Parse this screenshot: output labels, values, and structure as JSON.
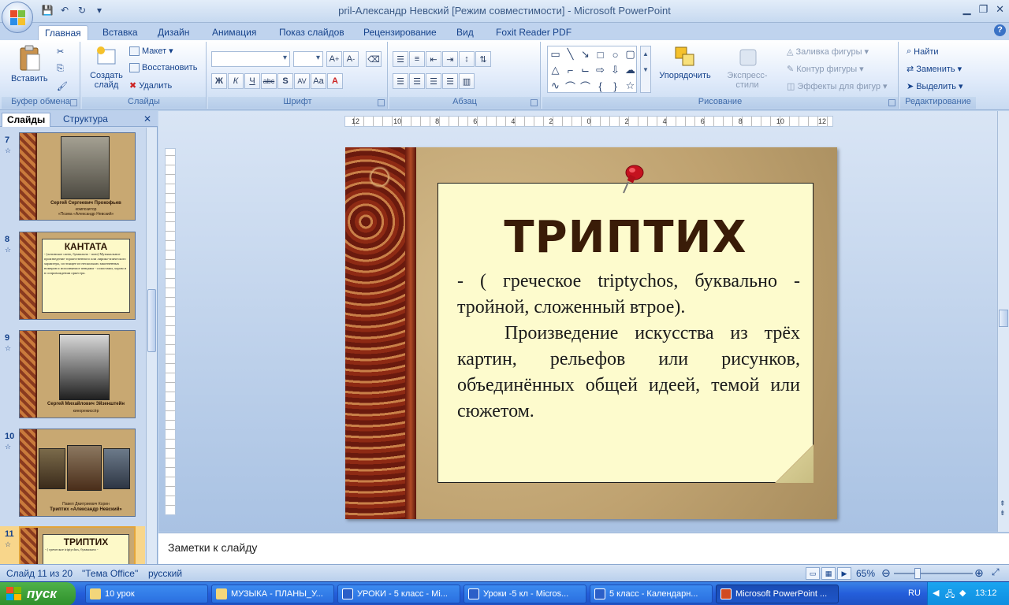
{
  "window": {
    "title": "pril-Александр Невский [Режим совместимости] - Microsoft PowerPoint"
  },
  "ribbon": {
    "tabs": [
      "Главная",
      "Вставка",
      "Дизайн",
      "Анимация",
      "Показ слайдов",
      "Рецензирование",
      "Вид",
      "Foxit Reader PDF"
    ],
    "active_tab": "Главная",
    "groups": {
      "clipboard": {
        "label": "Буфер обмена",
        "paste": "Вставить"
      },
      "slides": {
        "label": "Слайды",
        "new_slide": "Создать слайд",
        "layout": "Макет",
        "reset": "Восстановить",
        "delete": "Удалить"
      },
      "font": {
        "label": "Шрифт",
        "bold": "Ж",
        "italic": "К",
        "underline": "Ч",
        "strike": "abc",
        "shadow": "S",
        "spacing": "AV",
        "case": "Aa"
      },
      "paragraph": {
        "label": "Абзац"
      },
      "drawing": {
        "label": "Рисование",
        "arrange": "Упорядочить",
        "quick_styles": "Экспресс-стили",
        "fill": "Заливка фигуры",
        "outline": "Контур фигуры",
        "effects": "Эффекты для фигур"
      },
      "editing": {
        "label": "Редактирование",
        "find": "Найти",
        "replace": "Заменить",
        "select": "Выделить"
      }
    }
  },
  "left_panel": {
    "tabs": [
      "Слайды",
      "Структура"
    ],
    "active_tab": "Слайды",
    "thumbnails": [
      {
        "num": "7",
        "caption": "Сергей Сергеевич Прокофьев",
        "sub": "композитор",
        "sub2": "«Поэма «Александр Невский»"
      },
      {
        "num": "8",
        "title": "КАНТАТА",
        "body": "- (латинское canto, буквально - пою) Музыкальное произведение торжественного или лирико-эпического характера, состоящее из нескольких законченных номеров и исполняемое певцами - солистами, хором и в сопровождении оркестра."
      },
      {
        "num": "9",
        "caption": "Сергей Михайлович Эйзенштейн",
        "sub": "кинорежиссёр"
      },
      {
        "num": "10",
        "caption": "Триптих «Александр Невский»",
        "sub": "Павел Дмитриевич Корин"
      },
      {
        "num": "11",
        "title": "ТРИПТИХ",
        "body": "- ( греческое triptychos, буквально -",
        "selected": true
      }
    ]
  },
  "slide": {
    "title": "ТРИПТИХ",
    "body_line1": "- ( греческое triptychos, буквально - тройной, сложенный втрое).",
    "body_line2": "Произведение искусства из трёх картин, рельефов или рисунков, объединённых общей идеей, темой или сюжетом."
  },
  "rulers": {
    "h_labels": [
      "12",
      "10",
      "8",
      "6",
      "4",
      "2",
      "0",
      "2",
      "4",
      "6",
      "8",
      "10",
      "12"
    ]
  },
  "notes": {
    "placeholder": "Заметки к слайду"
  },
  "status": {
    "slide_counter": "Слайд 11 из 20",
    "theme": "\"Тема Office\"",
    "language": "русский",
    "zoom": "65%"
  },
  "taskbar": {
    "start": "пуск",
    "tasks": [
      "10 урок",
      "МУЗЫКА - ПЛАНЫ_У...",
      "УРОКИ - 5 класс - Mi...",
      "Уроки -5 кл - Micros...",
      "5 класс - Календарн...",
      "Microsoft PowerPoint ..."
    ],
    "active_task": 5,
    "lang": "RU",
    "clock": "13:12"
  },
  "colors": {
    "ribbon_accent": "#15428b",
    "note_fill": "#fdfbcd",
    "title_brown": "#3a1c08",
    "taskbar_blue": "#245edb",
    "start_green": "#2e8f2a"
  }
}
